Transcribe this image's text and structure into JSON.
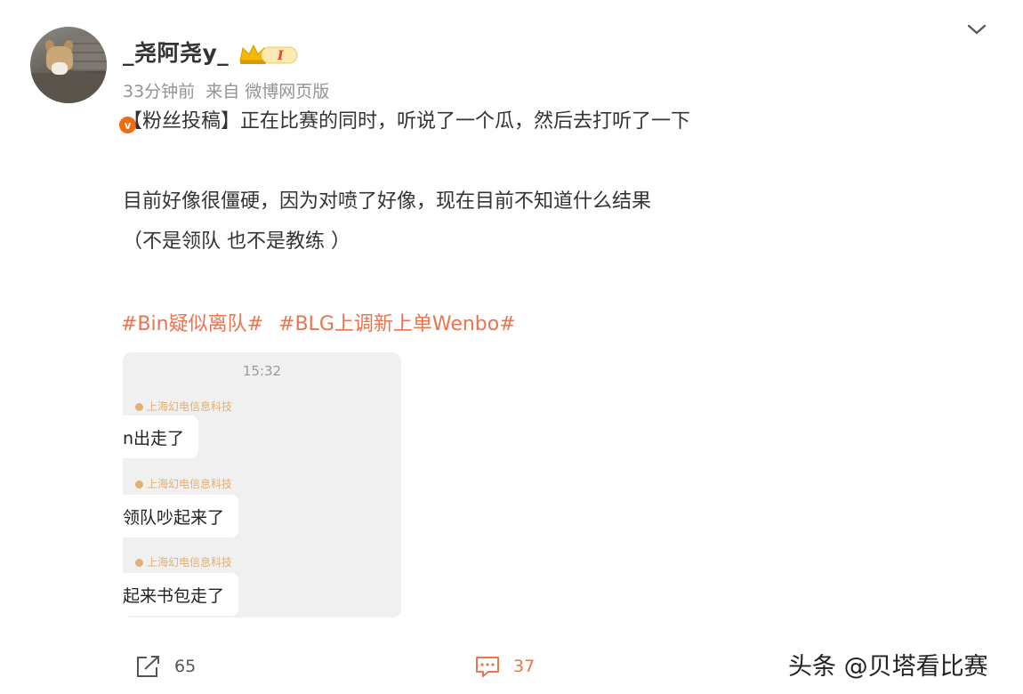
{
  "post": {
    "username": "_尧阿尧y_",
    "vip_level": "I",
    "verified_mark": "v",
    "time": "33分钟前",
    "source": "来自 微博网页版",
    "line1": "【粉丝投稿】正在比赛的同时，听说了一个瓜，然后去打听了一下",
    "line2": "目前好像很僵硬，因为对喷了好像，现在目前不知道什么结果",
    "line3": "（不是领队 也不是教练 ）",
    "hashtags": [
      "#Bin疑似离队#",
      "#BLG上调新上单Wenbo#"
    ]
  },
  "chat_image": {
    "time": "15:32",
    "messages": [
      {
        "sender": "上海幻电信息科技",
        "text": "n出走了"
      },
      {
        "sender": "上海幻电信息科技",
        "text": "领队吵起来了"
      },
      {
        "sender": "上海幻电信息科技",
        "text": "起来书包走了"
      }
    ]
  },
  "actions": {
    "repost_count": "65",
    "comment_count": "37"
  },
  "watermark": "头条 @贝塔看比赛",
  "colors": {
    "hashtag": "#eb7350",
    "verified_badge": "#f26b0f",
    "meta_text": "#939393"
  }
}
